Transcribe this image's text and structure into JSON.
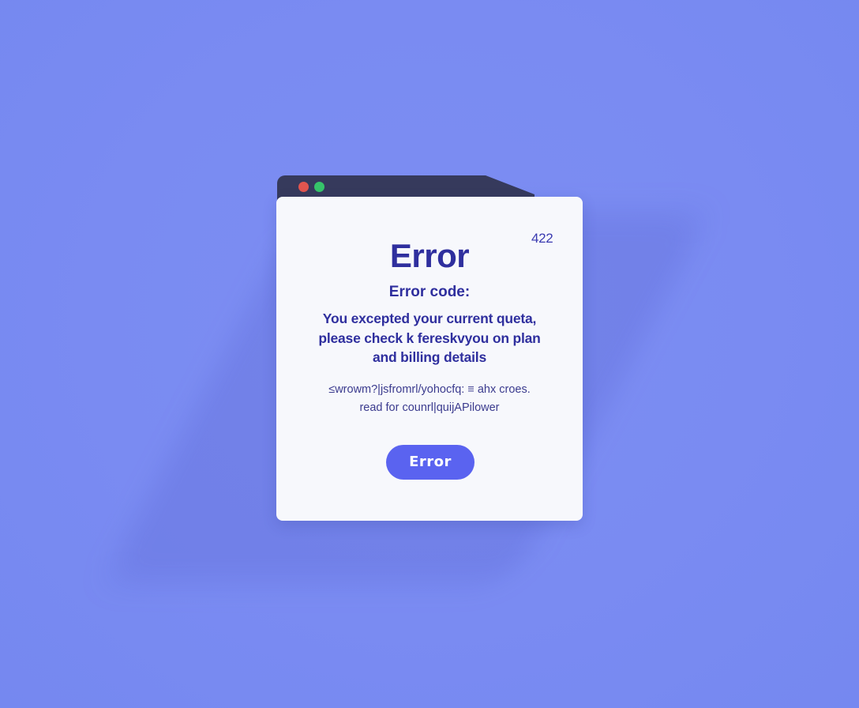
{
  "window": {
    "close_color": "#e2554f",
    "maximize_color": "#36c46a"
  },
  "dialog": {
    "status_code": "422",
    "title": "Error",
    "subtitle": "Error code:",
    "message": "You excepted your current queta, please check k fereskvyou on plan and billing details",
    "fine_print_line1": "≤wrowm?|jsfromrl/yohocfq: ≡ ahx croes.",
    "fine_print_line2": "read for counrl|quijAPilower",
    "button_label": "Error",
    "accent_color": "#5a63f0",
    "text_color": "#2f2f9e"
  }
}
